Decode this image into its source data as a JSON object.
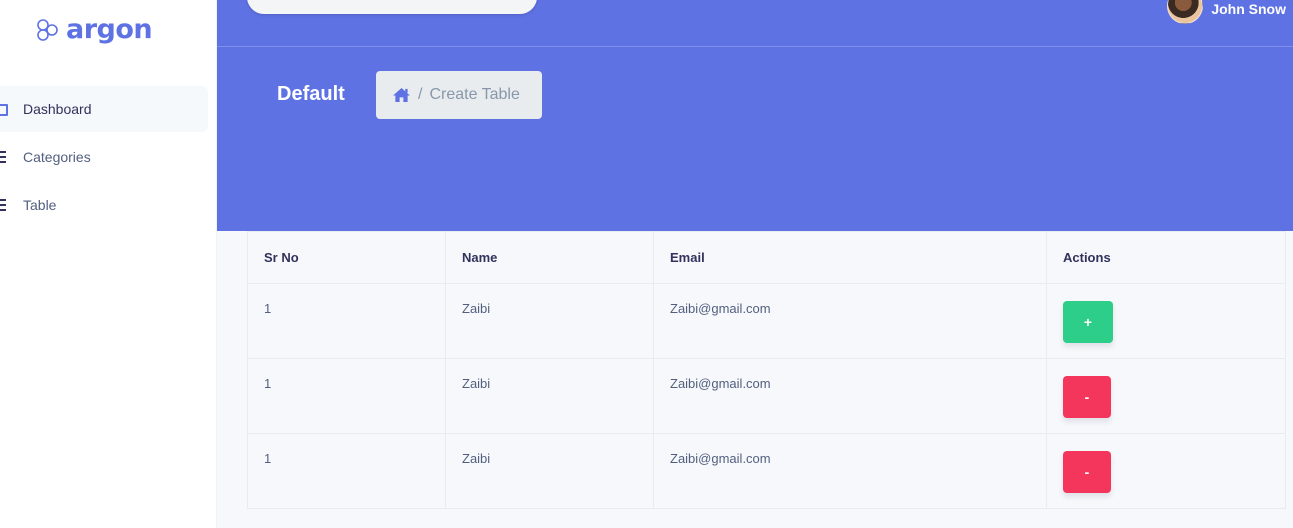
{
  "sidebar": {
    "brand": "argon",
    "items": [
      {
        "label": "Dashboard",
        "icon": "monitor-icon",
        "active": true
      },
      {
        "label": "Categories",
        "icon": "list-icon",
        "active": false
      },
      {
        "label": "Table",
        "icon": "list-icon",
        "active": false
      }
    ]
  },
  "header": {
    "user_name": "John Snow",
    "page_title": "Default",
    "breadcrumb": {
      "separator": "/",
      "current": "Create Table"
    },
    "accent_color": "#5e72e4"
  },
  "table": {
    "headers": [
      "Sr No",
      "Name",
      "Email",
      "Actions"
    ],
    "rows": [
      {
        "sr": "1",
        "name": "Zaibi",
        "email": "Zaibi@gmail.com",
        "action": "+",
        "action_color": "#2dce89"
      },
      {
        "sr": "1",
        "name": "Zaibi",
        "email": "Zaibi@gmail.com",
        "action": "-",
        "action_color": "#f5365c"
      },
      {
        "sr": "1",
        "name": "Zaibi",
        "email": "Zaibi@gmail.com",
        "action": "-",
        "action_color": "#f5365c"
      }
    ]
  }
}
